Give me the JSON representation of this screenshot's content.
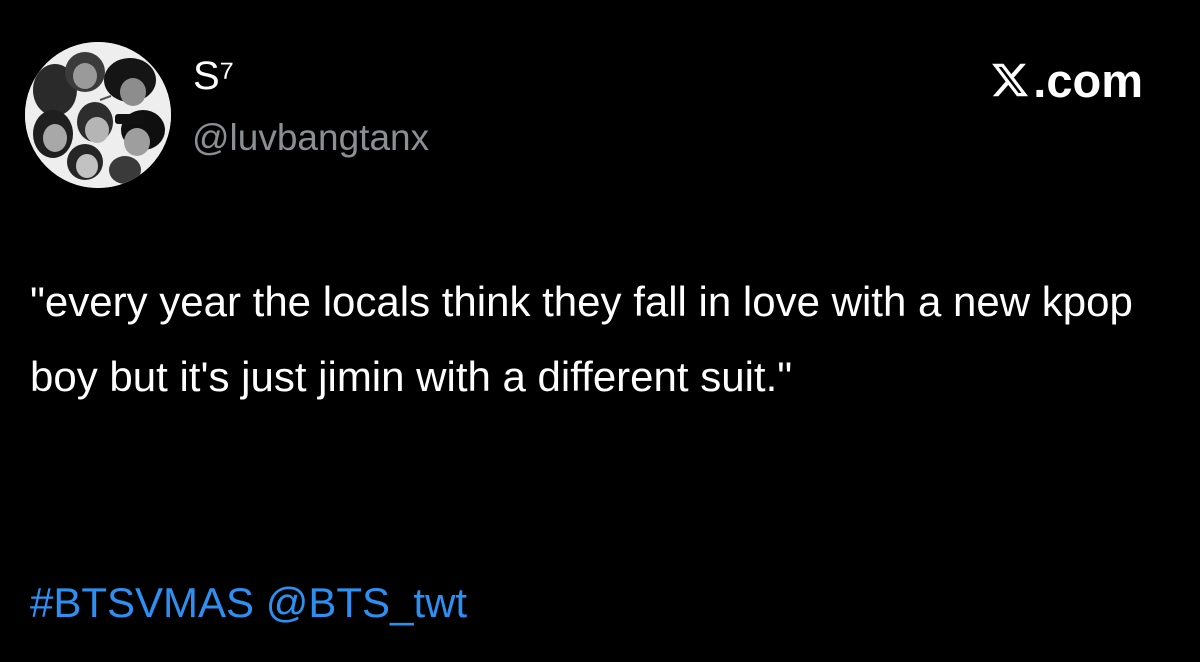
{
  "author": {
    "display_name": "S⁷",
    "handle": "@luvbangtanx",
    "avatar_icon": "group-photo-avatar"
  },
  "brand": {
    "label": ".com",
    "icon": "x-logo-icon"
  },
  "tweet": {
    "text": "\"every year the locals think they fall in love with a new kpop boy but it's just jimin with a different suit.\"",
    "hashtag": "#BTSVMAS",
    "mention": "@BTS_twt"
  },
  "colors": {
    "background": "#000000",
    "text": "#ffffff",
    "handle": "#8b8f94",
    "link": "#2e8ff2"
  }
}
